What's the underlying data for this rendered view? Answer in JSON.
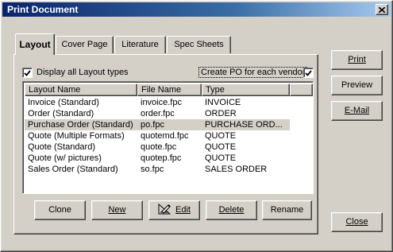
{
  "window": {
    "title": "Print Document"
  },
  "tabs": [
    {
      "label": "Layout",
      "active": true
    },
    {
      "label": "Cover Page",
      "active": false
    },
    {
      "label": "Literature",
      "active": false
    },
    {
      "label": "Spec Sheets",
      "active": false
    }
  ],
  "options": {
    "display_all_label": "Display all Layout types",
    "display_all_checked": true,
    "create_po_label": "Create PO for each vendor",
    "create_po_checked": true
  },
  "list": {
    "columns": [
      "Layout Name",
      "File Name",
      "Type"
    ],
    "rows": [
      {
        "name": "Invoice (Standard)",
        "file": "invoice.fpc",
        "type": "INVOICE",
        "selected": false
      },
      {
        "name": "Order (Standard)",
        "file": "order.fpc",
        "type": "ORDER",
        "selected": false
      },
      {
        "name": "Purchase Order (Standard)",
        "file": "po.fpc",
        "type": "PURCHASE ORD...",
        "selected": true
      },
      {
        "name": "Quote (Multiple Formats)",
        "file": "quotemd.fpc",
        "type": "QUOTE",
        "selected": false
      },
      {
        "name": "Quote (Standard)",
        "file": "quote.fpc",
        "type": "QUOTE",
        "selected": false
      },
      {
        "name": "Quote (w/ pictures)",
        "file": "quotep.fpc",
        "type": "QUOTE",
        "selected": false
      },
      {
        "name": "Sales Order (Standard)",
        "file": "so.fpc",
        "type": "SALES ORDER",
        "selected": false
      }
    ]
  },
  "buttons": {
    "clone": "Clone",
    "new": "New",
    "edit": "Edit",
    "delete": "Delete",
    "rename": "Rename",
    "print": "Print",
    "preview": "Preview",
    "email": "E-Mail",
    "close": "Close"
  },
  "icons": {
    "close": "close-icon",
    "check": "check-icon",
    "edit": "pencil-ruler-icon"
  }
}
